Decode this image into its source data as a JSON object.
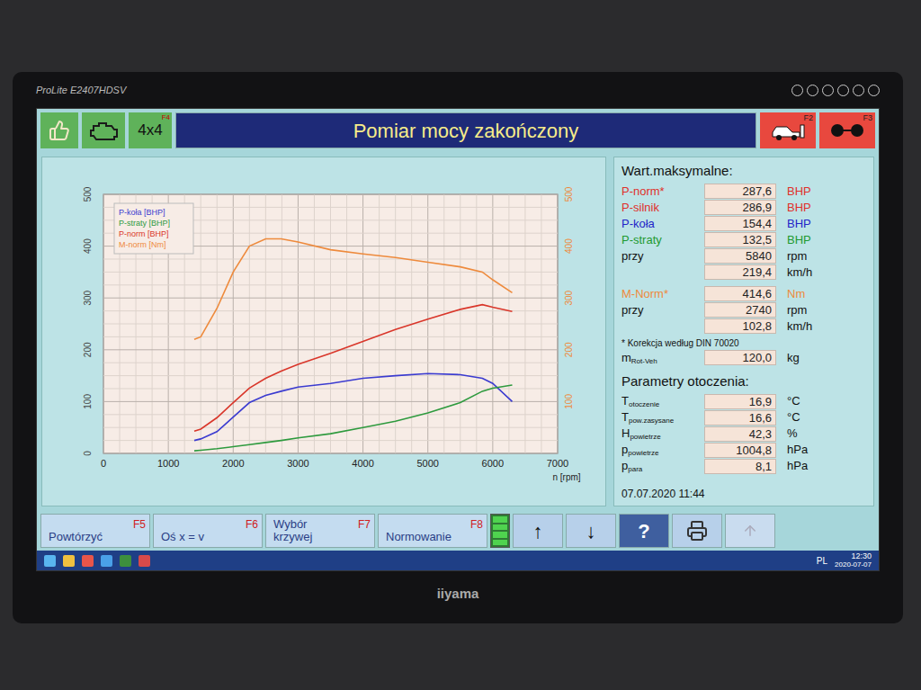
{
  "monitor": {
    "model": "ProLite E2407HDSV",
    "brand": "iiyama"
  },
  "header": {
    "title": "Pomiar mocy zakończony",
    "mode_label": "4x4",
    "mode_key": "F4",
    "buttons": [
      {
        "key": "F2"
      },
      {
        "key": "F3"
      }
    ]
  },
  "chart": {
    "legend": [
      {
        "label": "P-koła [BHP]",
        "color": "#3b3bd0"
      },
      {
        "label": "P-straty [BHP]",
        "color": "#2e9a3e"
      },
      {
        "label": "P-norm [BHP]",
        "color": "#d9362a"
      },
      {
        "label": "M-norm [Nm]",
        "color": "#ee8a3c"
      }
    ],
    "x_ticks": [
      "0",
      "1000",
      "2000",
      "3000",
      "4000",
      "5000",
      "6000",
      "7000"
    ],
    "x_label": "n [rpm]",
    "y_ticks": [
      "0",
      "100",
      "200",
      "300",
      "400",
      "500"
    ],
    "y2_ticks": [
      "100",
      "200",
      "300",
      "400",
      "500"
    ],
    "rpm": [
      1400,
      1500,
      1750,
      2000,
      2250,
      2500,
      2740,
      3000,
      3500,
      4000,
      4500,
      5000,
      5500,
      5840,
      6000,
      6300
    ],
    "series": [
      {
        "name": "P-koła",
        "color": "#3b3bd0",
        "values": [
          25,
          28,
          42,
          70,
          98,
          112,
          120,
          128,
          135,
          145,
          150,
          154,
          152,
          145,
          135,
          100
        ]
      },
      {
        "name": "P-straty",
        "color": "#2e9a3e",
        "values": [
          5,
          6,
          9,
          13,
          17,
          21,
          25,
          30,
          38,
          50,
          62,
          78,
          98,
          120,
          126,
          132
        ]
      },
      {
        "name": "P-norm",
        "color": "#d9362a",
        "values": [
          43,
          47,
          69,
          98,
          126,
          145,
          159,
          172,
          193,
          216,
          239,
          259,
          278,
          287,
          282,
          274
        ]
      },
      {
        "name": "M-norm",
        "color": "#ee8a3c",
        "values": [
          220,
          225,
          280,
          350,
          400,
          414,
          414,
          408,
          393,
          385,
          378,
          369,
          360,
          350,
          335,
          310
        ]
      }
    ]
  },
  "max_values": {
    "title": "Wart.maksymalne:",
    "rows": [
      {
        "label": "P-norm*",
        "value": "287,6",
        "unit": "BHP",
        "color": "#e0302a"
      },
      {
        "label": "P-silnik",
        "value": "286,9",
        "unit": "BHP",
        "color": "#e0302a"
      },
      {
        "label": "P-koła",
        "value": "154,4",
        "unit": "BHP",
        "color": "#2323c8"
      },
      {
        "label": "P-straty",
        "value": "132,5",
        "unit": "BHP",
        "color": "#1e9a30"
      },
      {
        "label": "przy",
        "value": "5840",
        "unit": "rpm",
        "color": "#111111"
      },
      {
        "label": "",
        "value": "219,4",
        "unit": "km/h",
        "color": "#111111"
      }
    ],
    "torque_rows": [
      {
        "label": "M-Norm*",
        "value": "414,6",
        "unit": "Nm",
        "color": "#ee8a3c"
      },
      {
        "label": "przy",
        "value": "2740",
        "unit": "rpm",
        "color": "#111111"
      },
      {
        "label": "",
        "value": "102,8",
        "unit": "km/h",
        "color": "#111111"
      }
    ],
    "note": "* Korekcja według DIN 70020",
    "mass": {
      "symbol": "m",
      "sub": "Rot-Veh",
      "value": "120,0",
      "unit": "kg"
    }
  },
  "ambient": {
    "title": "Parametry otoczenia:",
    "rows": [
      {
        "symbol": "T",
        "sub": "otoczenie",
        "value": "16,9",
        "unit": "°C"
      },
      {
        "symbol": "T",
        "sub": "pow.zasysane",
        "value": "16,6",
        "unit": "°C"
      },
      {
        "symbol": "H",
        "sub": "powietrze",
        "value": "42,3",
        "unit": "%"
      },
      {
        "symbol": "p",
        "sub": "powietrze",
        "value": "1004,8",
        "unit": "hPa"
      },
      {
        "symbol": "p",
        "sub": "para",
        "value": "8,1",
        "unit": "hPa"
      }
    ]
  },
  "timestamp": "07.07.2020 11:44",
  "function_keys": [
    {
      "label": "Powtórzyć",
      "key": "F5"
    },
    {
      "label": "Oś x = v",
      "key": "F6"
    },
    {
      "label": "Wybór krzywej",
      "key": "F7"
    },
    {
      "label": "Normowanie",
      "key": "F8"
    }
  ],
  "nav_buttons": [
    "↑",
    "↓",
    "?"
  ],
  "taskbar": {
    "language": "PL",
    "time": "12:30",
    "date": "2020-07-07"
  }
}
